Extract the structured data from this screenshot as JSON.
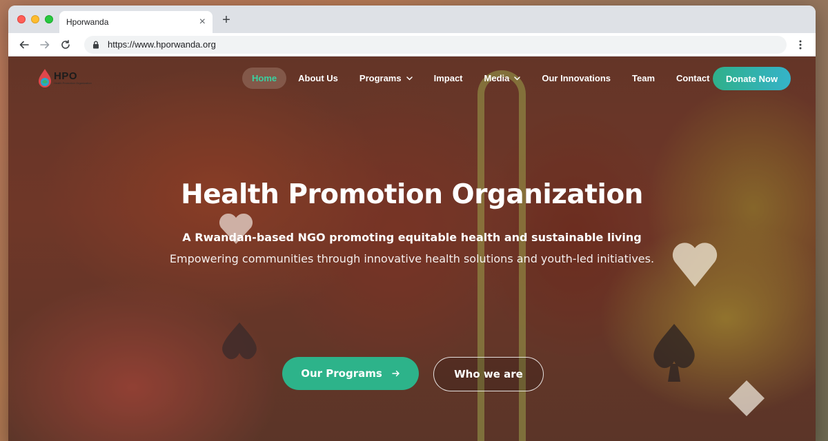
{
  "browser": {
    "tab_title": "Hporwanda",
    "tab_close_icon": "close-icon",
    "new_tab_label": "+",
    "url": "https://www.hporwanda.org"
  },
  "site": {
    "logo": {
      "wordmark": "HPO",
      "tagline": "Health Promotion Organization"
    },
    "nav": {
      "items": [
        {
          "label": "Home",
          "active": true,
          "dropdown": false
        },
        {
          "label": "About Us",
          "active": false,
          "dropdown": false
        },
        {
          "label": "Programs",
          "active": false,
          "dropdown": true
        },
        {
          "label": "Impact",
          "active": false,
          "dropdown": false
        },
        {
          "label": "Media",
          "active": false,
          "dropdown": true
        },
        {
          "label": "Our Innovations",
          "active": false,
          "dropdown": false
        },
        {
          "label": "Team",
          "active": false,
          "dropdown": false
        },
        {
          "label": "Contact",
          "active": false,
          "dropdown": false
        }
      ],
      "donate_label": "Donate Now"
    },
    "hero": {
      "title": "Health Promotion Organization",
      "subtitle": "A Rwandan-based NGO promoting equitable health and sustainable living",
      "description": "Empowering communities through innovative health solutions and youth-led initiatives.",
      "primary_cta": "Our Programs",
      "secondary_cta": "Who we are"
    }
  },
  "colors": {
    "accent_green": "#2db38a",
    "active_nav_text": "#3ad1a0",
    "donate_gradient_start": "#2fb08a",
    "donate_gradient_end": "#35b3c9"
  }
}
